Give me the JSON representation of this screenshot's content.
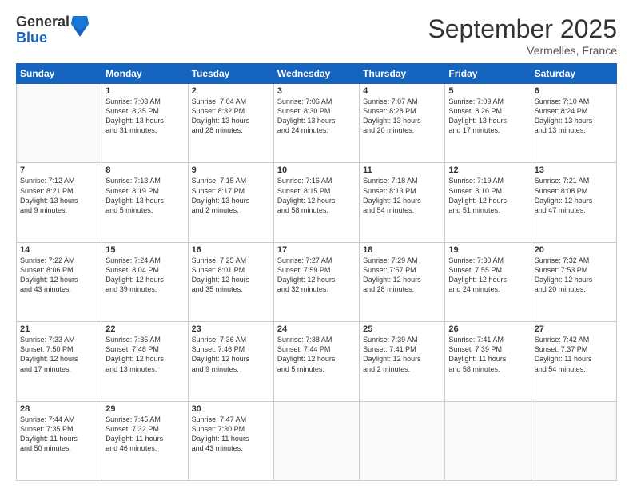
{
  "header": {
    "logo_line1": "General",
    "logo_line2": "Blue",
    "month_title": "September 2025",
    "location": "Vermelles, France"
  },
  "columns": [
    "Sunday",
    "Monday",
    "Tuesday",
    "Wednesday",
    "Thursday",
    "Friday",
    "Saturday"
  ],
  "weeks": [
    [
      {
        "day": "",
        "info": ""
      },
      {
        "day": "1",
        "info": "Sunrise: 7:03 AM\nSunset: 8:35 PM\nDaylight: 13 hours\nand 31 minutes."
      },
      {
        "day": "2",
        "info": "Sunrise: 7:04 AM\nSunset: 8:32 PM\nDaylight: 13 hours\nand 28 minutes."
      },
      {
        "day": "3",
        "info": "Sunrise: 7:06 AM\nSunset: 8:30 PM\nDaylight: 13 hours\nand 24 minutes."
      },
      {
        "day": "4",
        "info": "Sunrise: 7:07 AM\nSunset: 8:28 PM\nDaylight: 13 hours\nand 20 minutes."
      },
      {
        "day": "5",
        "info": "Sunrise: 7:09 AM\nSunset: 8:26 PM\nDaylight: 13 hours\nand 17 minutes."
      },
      {
        "day": "6",
        "info": "Sunrise: 7:10 AM\nSunset: 8:24 PM\nDaylight: 13 hours\nand 13 minutes."
      }
    ],
    [
      {
        "day": "7",
        "info": "Sunrise: 7:12 AM\nSunset: 8:21 PM\nDaylight: 13 hours\nand 9 minutes."
      },
      {
        "day": "8",
        "info": "Sunrise: 7:13 AM\nSunset: 8:19 PM\nDaylight: 13 hours\nand 5 minutes."
      },
      {
        "day": "9",
        "info": "Sunrise: 7:15 AM\nSunset: 8:17 PM\nDaylight: 13 hours\nand 2 minutes."
      },
      {
        "day": "10",
        "info": "Sunrise: 7:16 AM\nSunset: 8:15 PM\nDaylight: 12 hours\nand 58 minutes."
      },
      {
        "day": "11",
        "info": "Sunrise: 7:18 AM\nSunset: 8:13 PM\nDaylight: 12 hours\nand 54 minutes."
      },
      {
        "day": "12",
        "info": "Sunrise: 7:19 AM\nSunset: 8:10 PM\nDaylight: 12 hours\nand 51 minutes."
      },
      {
        "day": "13",
        "info": "Sunrise: 7:21 AM\nSunset: 8:08 PM\nDaylight: 12 hours\nand 47 minutes."
      }
    ],
    [
      {
        "day": "14",
        "info": "Sunrise: 7:22 AM\nSunset: 8:06 PM\nDaylight: 12 hours\nand 43 minutes."
      },
      {
        "day": "15",
        "info": "Sunrise: 7:24 AM\nSunset: 8:04 PM\nDaylight: 12 hours\nand 39 minutes."
      },
      {
        "day": "16",
        "info": "Sunrise: 7:25 AM\nSunset: 8:01 PM\nDaylight: 12 hours\nand 35 minutes."
      },
      {
        "day": "17",
        "info": "Sunrise: 7:27 AM\nSunset: 7:59 PM\nDaylight: 12 hours\nand 32 minutes."
      },
      {
        "day": "18",
        "info": "Sunrise: 7:29 AM\nSunset: 7:57 PM\nDaylight: 12 hours\nand 28 minutes."
      },
      {
        "day": "19",
        "info": "Sunrise: 7:30 AM\nSunset: 7:55 PM\nDaylight: 12 hours\nand 24 minutes."
      },
      {
        "day": "20",
        "info": "Sunrise: 7:32 AM\nSunset: 7:53 PM\nDaylight: 12 hours\nand 20 minutes."
      }
    ],
    [
      {
        "day": "21",
        "info": "Sunrise: 7:33 AM\nSunset: 7:50 PM\nDaylight: 12 hours\nand 17 minutes."
      },
      {
        "day": "22",
        "info": "Sunrise: 7:35 AM\nSunset: 7:48 PM\nDaylight: 12 hours\nand 13 minutes."
      },
      {
        "day": "23",
        "info": "Sunrise: 7:36 AM\nSunset: 7:46 PM\nDaylight: 12 hours\nand 9 minutes."
      },
      {
        "day": "24",
        "info": "Sunrise: 7:38 AM\nSunset: 7:44 PM\nDaylight: 12 hours\nand 5 minutes."
      },
      {
        "day": "25",
        "info": "Sunrise: 7:39 AM\nSunset: 7:41 PM\nDaylight: 12 hours\nand 2 minutes."
      },
      {
        "day": "26",
        "info": "Sunrise: 7:41 AM\nSunset: 7:39 PM\nDaylight: 11 hours\nand 58 minutes."
      },
      {
        "day": "27",
        "info": "Sunrise: 7:42 AM\nSunset: 7:37 PM\nDaylight: 11 hours\nand 54 minutes."
      }
    ],
    [
      {
        "day": "28",
        "info": "Sunrise: 7:44 AM\nSunset: 7:35 PM\nDaylight: 11 hours\nand 50 minutes."
      },
      {
        "day": "29",
        "info": "Sunrise: 7:45 AM\nSunset: 7:32 PM\nDaylight: 11 hours\nand 46 minutes."
      },
      {
        "day": "30",
        "info": "Sunrise: 7:47 AM\nSunset: 7:30 PM\nDaylight: 11 hours\nand 43 minutes."
      },
      {
        "day": "",
        "info": ""
      },
      {
        "day": "",
        "info": ""
      },
      {
        "day": "",
        "info": ""
      },
      {
        "day": "",
        "info": ""
      }
    ]
  ]
}
